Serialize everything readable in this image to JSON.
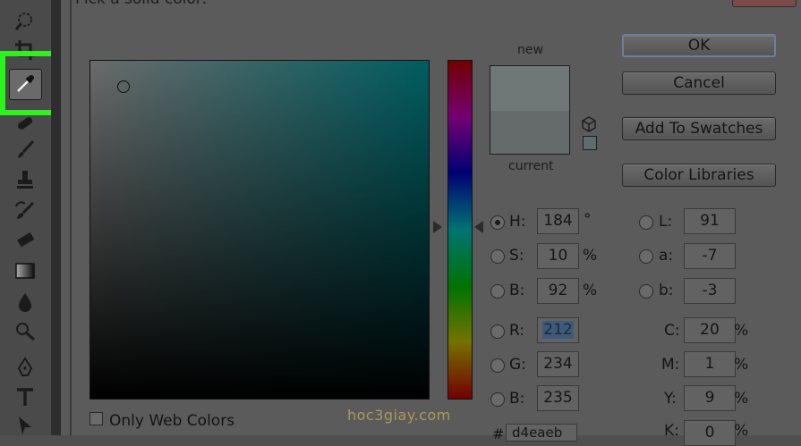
{
  "dialog": {
    "title": "Pick a solid color:",
    "only_web_colors_label": "Only Web Colors",
    "only_web_colors_checked": false
  },
  "preview": {
    "new_label": "new",
    "current_label": "current",
    "new_color": "#6f7777",
    "current_color": "#656b6b"
  },
  "buttons": {
    "ok": "OK",
    "cancel": "Cancel",
    "add_to_swatches": "Add To Swatches",
    "color_libraries": "Color Libraries"
  },
  "hsb": {
    "h": {
      "label": "H:",
      "value": "184",
      "unit": "°",
      "selected": true
    },
    "s": {
      "label": "S:",
      "value": "10",
      "unit": "%"
    },
    "b": {
      "label": "B:",
      "value": "92",
      "unit": "%"
    }
  },
  "rgb": {
    "r": {
      "label": "R:",
      "value": "212"
    },
    "g": {
      "label": "G:",
      "value": "234"
    },
    "b": {
      "label": "B:",
      "value": "235"
    }
  },
  "lab": {
    "l": {
      "label": "L:",
      "value": "91"
    },
    "a": {
      "label": "a:",
      "value": "-7"
    },
    "b": {
      "label": "b:",
      "value": "-3"
    }
  },
  "cmyk": {
    "c": {
      "label": "C:",
      "value": "20",
      "unit": "%"
    },
    "m": {
      "label": "M:",
      "value": "1",
      "unit": "%"
    },
    "y": {
      "label": "Y:",
      "value": "9",
      "unit": "%"
    },
    "k": {
      "label": "K:",
      "value": "0",
      "unit": "%"
    }
  },
  "hex": {
    "label": "#",
    "value": "d4eaeb"
  },
  "watermark": "hoc3giay.com",
  "toolbar": {
    "active_tool": "eyedropper-icon",
    "highlight_color": "#2cf31e",
    "tools": [
      "quick-selection-icon",
      "crop-icon",
      "eyedropper-icon",
      "spot-healing-icon",
      "brush-icon",
      "clone-stamp-icon",
      "history-brush-icon",
      "eraser-icon",
      "gradient-icon",
      "blur-icon",
      "dodge-icon",
      "pen-icon",
      "type-icon",
      "path-selection-icon"
    ]
  }
}
